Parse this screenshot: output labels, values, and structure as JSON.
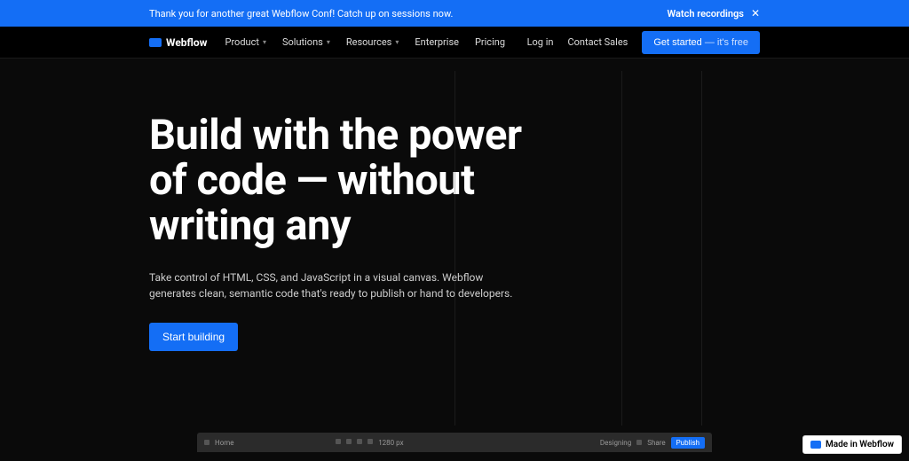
{
  "banner": {
    "message": "Thank you for another great Webflow Conf! Catch up on sessions now.",
    "link_label": "Watch recordings",
    "close_symbol": "✕"
  },
  "brand": {
    "name": "Webflow"
  },
  "nav": {
    "items": [
      {
        "label": "Product",
        "has_dropdown": true
      },
      {
        "label": "Solutions",
        "has_dropdown": true
      },
      {
        "label": "Resources",
        "has_dropdown": true
      },
      {
        "label": "Enterprise",
        "has_dropdown": false
      },
      {
        "label": "Pricing",
        "has_dropdown": false
      }
    ],
    "login": "Log in",
    "contact": "Contact Sales",
    "cta_primary": "Get started",
    "cta_secondary": " — it's free"
  },
  "hero": {
    "headline": "Build with the power of code — without writing any",
    "subhead": "Take control of HTML, CSS, and JavaScript in a visual canvas. Webflow generates clean, semantic code that's ready to publish or hand to developers.",
    "button": "Start building"
  },
  "designer": {
    "page_label": "Home",
    "breakpoint": "1280 px",
    "panel": "Designing",
    "share": "Share",
    "publish": "Publish"
  },
  "badge": {
    "label": "Made in Webflow"
  },
  "colors": {
    "accent": "#146ef5"
  }
}
